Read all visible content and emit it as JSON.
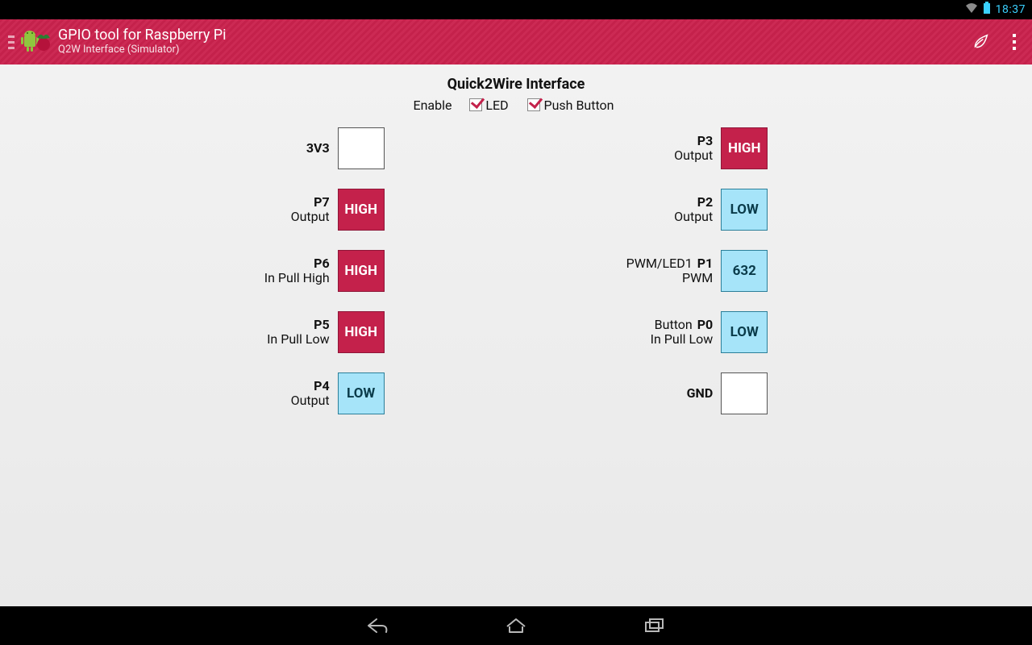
{
  "status": {
    "time": "18:37"
  },
  "actionbar": {
    "title": "GPIO tool for Raspberry Pi",
    "subtitle": "Q2W Interface (Simulator)"
  },
  "section": {
    "title": "Quick2Wire Interface",
    "enable_label": "Enable",
    "led_label": "LED",
    "led_checked": true,
    "pushbutton_label": "Push Button",
    "pushbutton_checked": true
  },
  "left_pins": [
    {
      "extra": "",
      "name": "3V3",
      "mode": "",
      "state": "",
      "kind": "blank"
    },
    {
      "extra": "",
      "name": "P7",
      "mode": "Output",
      "state": "HIGH",
      "kind": "high"
    },
    {
      "extra": "",
      "name": "P6",
      "mode": "In Pull High",
      "state": "HIGH",
      "kind": "high"
    },
    {
      "extra": "",
      "name": "P5",
      "mode": "In Pull Low",
      "state": "HIGH",
      "kind": "high"
    },
    {
      "extra": "",
      "name": "P4",
      "mode": "Output",
      "state": "LOW",
      "kind": "low"
    }
  ],
  "right_pins": [
    {
      "extra": "",
      "name": "P3",
      "mode": "Output",
      "state": "HIGH",
      "kind": "high"
    },
    {
      "extra": "",
      "name": "P2",
      "mode": "Output",
      "state": "LOW",
      "kind": "low"
    },
    {
      "extra": "PWM/LED1",
      "name": "P1",
      "mode": "PWM",
      "state": "632",
      "kind": "val"
    },
    {
      "extra": "Button",
      "name": "P0",
      "mode": "In Pull Low",
      "state": "LOW",
      "kind": "low"
    },
    {
      "extra": "",
      "name": "GND",
      "mode": "",
      "state": "",
      "kind": "blank"
    }
  ]
}
